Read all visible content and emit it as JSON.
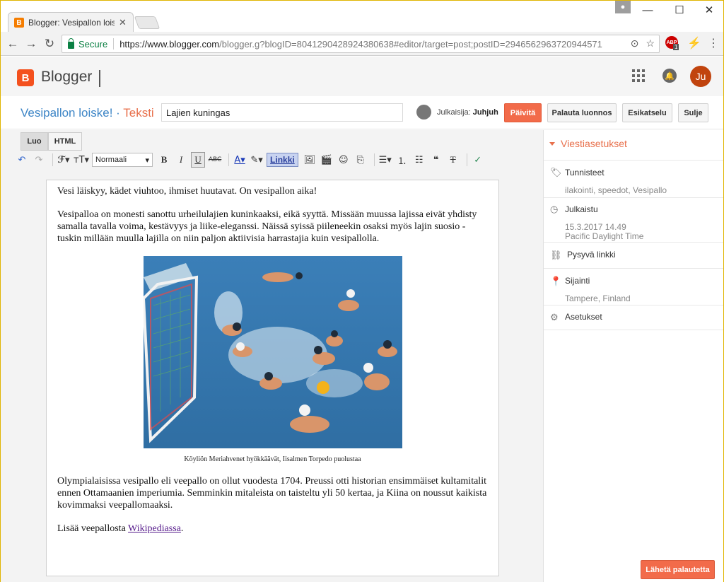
{
  "browser": {
    "tab_title": "Blogger: Vesipallon loiske",
    "tab_favicon": "B",
    "secure_label": "Secure",
    "url_main": "https://www.blogger.com",
    "url_rest": "/blogger.g?blogID=8041290428924380638#editor/target=post;postID=2946562963720944571",
    "profile_icon": "person-icon",
    "adblock_badge": "1"
  },
  "header": {
    "logo_letter": "B",
    "brand": "Blogger",
    "avatar_initials": "Ju"
  },
  "post": {
    "blog_name": "Vesipallon loiske!",
    "separator": " · ",
    "page_type": "Teksti",
    "title_value": "Lajien kuningas",
    "author_label": "Julkaisija: ",
    "author_name": "Juhjuh"
  },
  "actions": {
    "update": "Päivitä",
    "revert": "Palauta luonnos",
    "preview": "Esikatselu",
    "close": "Sulje"
  },
  "editor": {
    "mode_compose": "Luo",
    "mode_html": "HTML",
    "format_value": "Normaali",
    "link_label": "Linkki",
    "paragraphs": [
      "Vesi läiskyy, kädet viuhtoo, ihmiset huutavat. On vesipallon aika!",
      "Vesipalloa on monesti sanottu urheilulajien kuninkaaksi, eikä syyttä. Missään muussa lajissa eivät yhdisty samalla tavalla voima, kestävyys ja liike-eleganssi. Näissä syissä piileneekin osaksi myös lajin suosio - tuskin millään muulla lajilla on niin paljon aktiivisia harrastajia kuin vesipallolla.",
      "Olympialaisissa vesipallo eli veepallo on ollut vuodesta 1704. Preussi otti historian ensimmäiset kultamitalit ennen Ottamaanien imperiumia. Semminkin mitaleista on taisteltu yli 50 kertaa, ja Kiina on noussut kaikista kovimmaksi veepallomaaksi."
    ],
    "caption": "Köyliön Meriahvenet hyökkäävät, Iisalmen Torpedo puolustaa",
    "last_line_prefix": "Lisää veepallosta ",
    "last_line_link": "Wikipediassa",
    "last_line_suffix": "."
  },
  "sidebar": {
    "heading": "Viestiasetukset",
    "labels": {
      "title": "Tunnisteet",
      "value": "ilakointi, speedot, Vesipallo"
    },
    "published": {
      "title": "Julkaistu",
      "date": "15.3.2017 14.49",
      "tz": "Pacific Daylight Time"
    },
    "permalink": {
      "title": "Pysyvä linkki"
    },
    "location": {
      "title": "Sijainti",
      "value": "Tampere, Finland"
    },
    "settings": {
      "title": "Asetukset"
    }
  },
  "feedback": "Lähetä palautetta",
  "colors": {
    "brand": "#f4511e",
    "accent": "#f26b4a",
    "blog_title": "#3d85c6"
  }
}
